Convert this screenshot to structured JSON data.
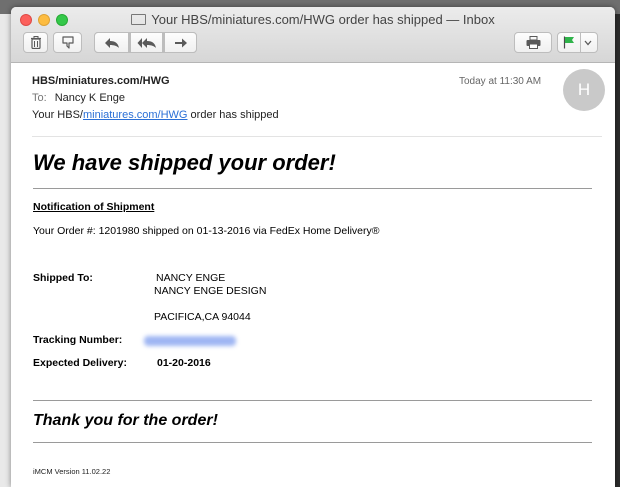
{
  "window": {
    "title": "Your HBS/miniatures.com/HWG order has shipped — Inbox"
  },
  "icons": [
    "envelope-icon",
    "trash-icon",
    "junk-icon",
    "reply-icon",
    "reply-all-icon",
    "forward-icon",
    "print-icon",
    "flag-icon",
    "chevron-down-icon"
  ],
  "colors": {
    "link": "#2a6fd6",
    "flag": "#2fb34a",
    "avatar": "#c9c9c9"
  },
  "message": {
    "from": "HBS/miniatures.com/HWG",
    "to_label": "To:",
    "to": "Nancy K Enge",
    "subject_prefix": "Your HBS/",
    "subject_link": "miniatures.com/HWG",
    "subject_suffix": " order has shipped",
    "date": "Today at 11:30 AM",
    "avatar_initial": "H"
  },
  "body": {
    "headline": "We have shipped your order!",
    "notification_title": "Notification of Shipment",
    "order_line": "Your Order #: 1201980 shipped on 01-13-2016 via FedEx Home Delivery®",
    "shipped_to_label": "Shipped To:",
    "shipped_to_name": "NANCY ENGE",
    "shipped_to_company": "NANCY ENGE DESIGN",
    "shipped_to_city": "PACIFICA,CA 94044",
    "tracking_label": "Tracking Number:",
    "expected_label": "Expected Delivery:",
    "expected_date": "01-20-2016",
    "thanks": "Thank you for the order!",
    "version": "iMCM Version 11.02.22"
  }
}
